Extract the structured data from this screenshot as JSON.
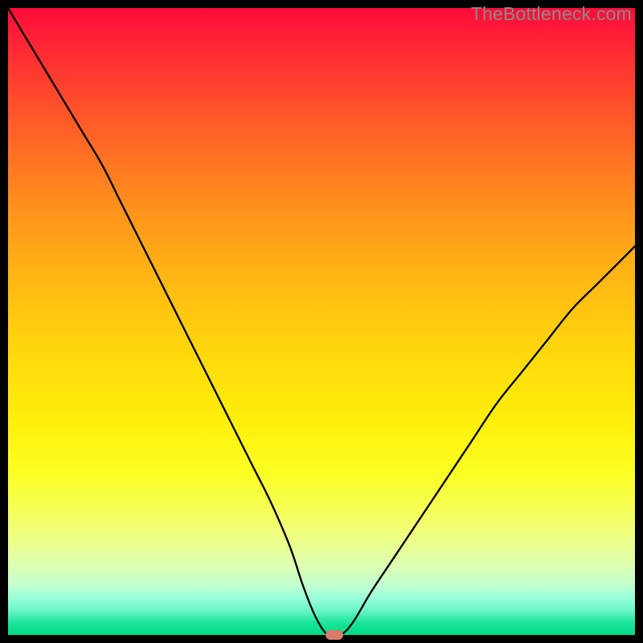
{
  "watermark": "TheBottleneck.com",
  "colors": {
    "curve": "#000000",
    "marker": "#d97b6a"
  },
  "chart_data": {
    "type": "line",
    "title": "",
    "xlabel": "",
    "ylabel": "",
    "xlim": [
      0,
      100
    ],
    "ylim": [
      0,
      100
    ],
    "grid": false,
    "legend": false,
    "series": [
      {
        "name": "bottleneck-curve",
        "x": [
          0,
          3,
          6,
          9,
          12,
          15,
          18,
          21,
          24,
          27,
          30,
          33,
          36,
          39,
          42,
          45,
          47,
          49,
          51,
          53,
          55,
          58,
          62,
          66,
          70,
          74,
          78,
          82,
          86,
          90,
          94,
          98,
          100
        ],
        "y": [
          100,
          95,
          90,
          85,
          80,
          75,
          69,
          63,
          57,
          51,
          45,
          39,
          33,
          27,
          21,
          14,
          8,
          3,
          0,
          0,
          2,
          7,
          13,
          19,
          25,
          31,
          37,
          42,
          47,
          52,
          56,
          60,
          62
        ]
      }
    ],
    "optimum": {
      "x": 52,
      "y": 0
    }
  }
}
